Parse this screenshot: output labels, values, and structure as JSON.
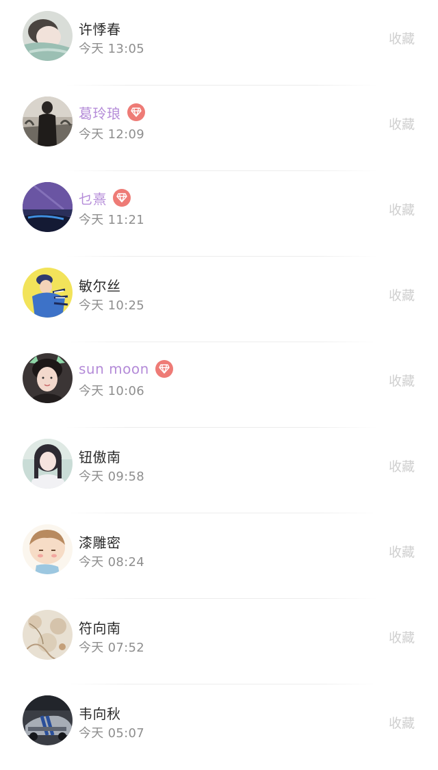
{
  "contacts": [
    {
      "name": "许悸春",
      "time": "今天 13:05",
      "action": "收藏",
      "vip": false
    },
    {
      "name": "葛玲琅",
      "time": "今天 12:09",
      "action": "收藏",
      "vip": true
    },
    {
      "name": "乜熹",
      "time": "今天 11:21",
      "action": "收藏",
      "vip": true
    },
    {
      "name": "敏尔丝",
      "time": "今天 10:25",
      "action": "收藏",
      "vip": false
    },
    {
      "name": "sun moon",
      "time": "今天 10:06",
      "action": "收藏",
      "vip": true
    },
    {
      "name": "钮傲南",
      "time": "今天 09:58",
      "action": "收藏",
      "vip": false
    },
    {
      "name": "漆雕密",
      "time": "今天 08:24",
      "action": "收藏",
      "vip": false
    },
    {
      "name": "符向南",
      "time": "今天 07:52",
      "action": "收藏",
      "vip": false
    },
    {
      "name": "韦向秋",
      "time": "今天 05:07",
      "action": "收藏",
      "vip": false
    }
  ],
  "colors": {
    "vip_name": "#b48bd8",
    "normal_name": "#2b2b2b",
    "time": "#8e8e8e",
    "action": "#cfcfcf",
    "badge": "#ee7b76"
  },
  "icons": {
    "vip_badge": "diamond-icon"
  }
}
